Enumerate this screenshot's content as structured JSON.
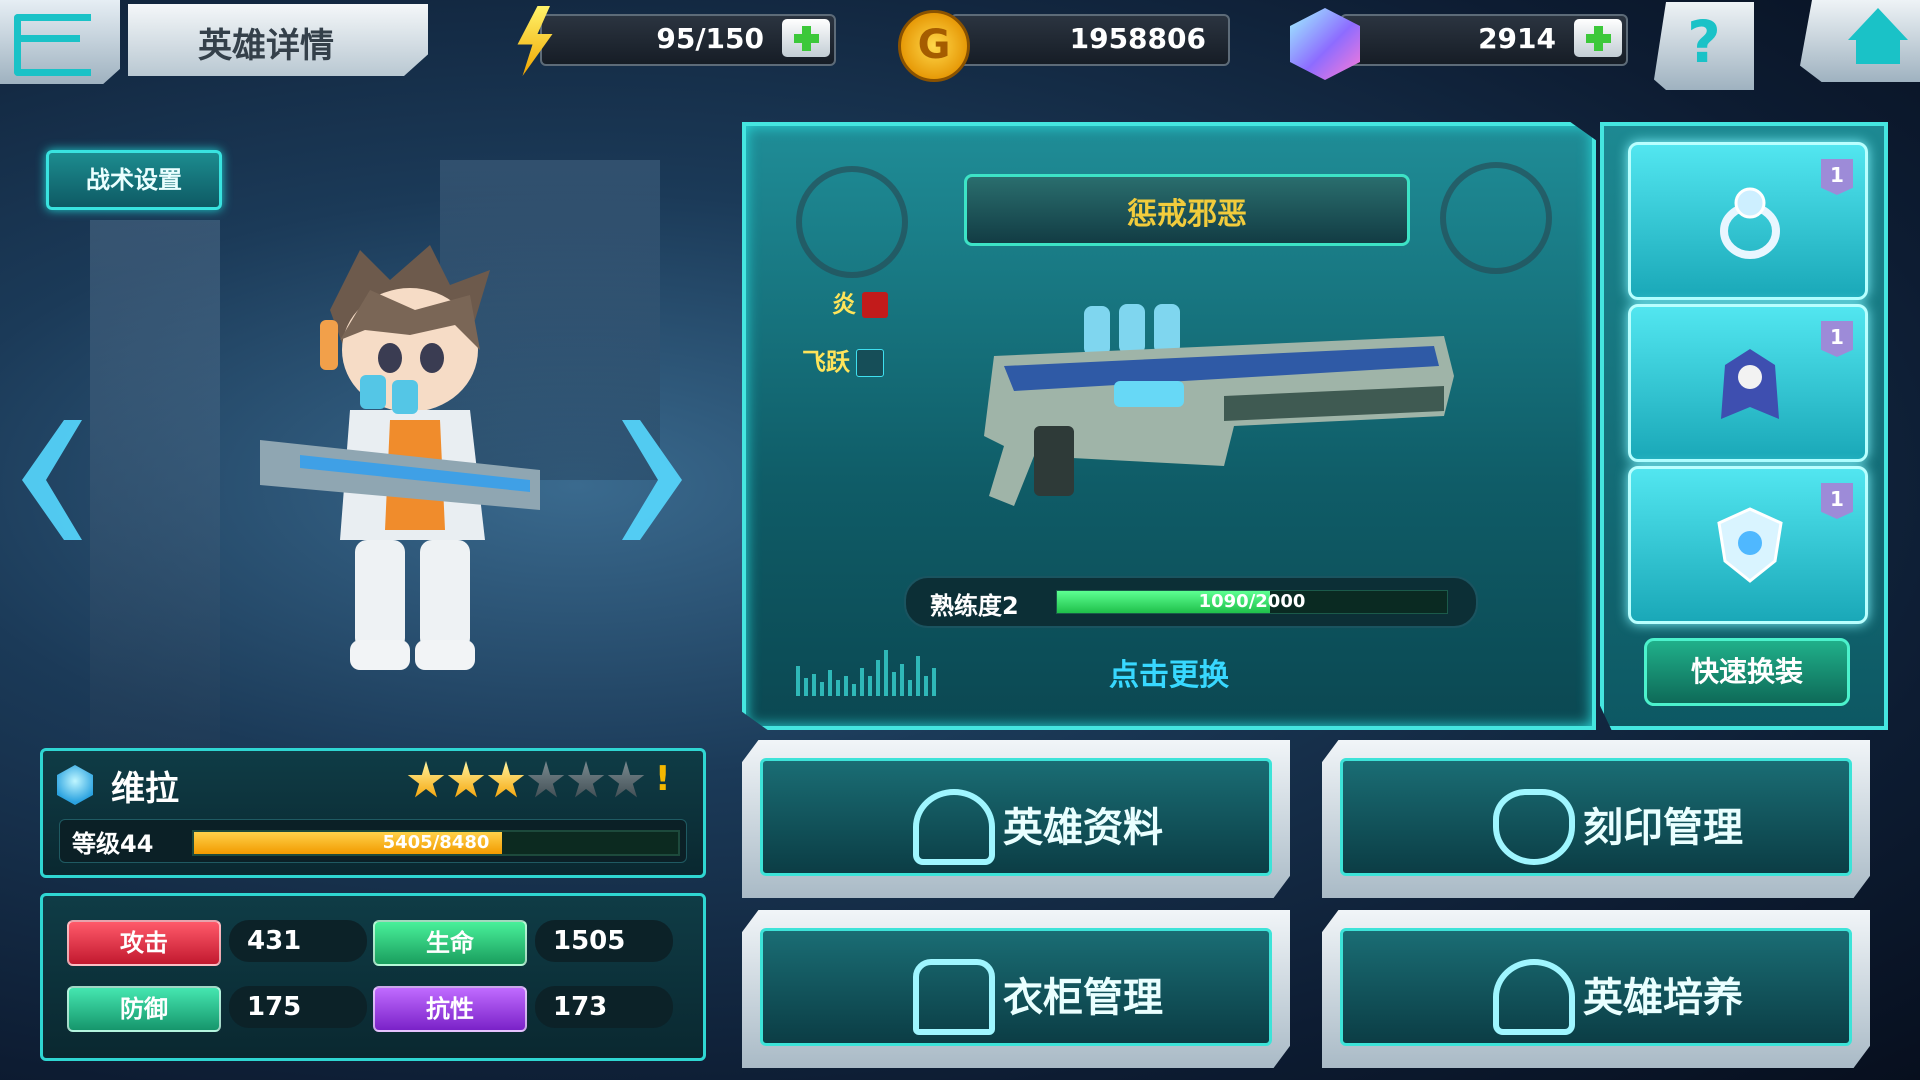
{
  "header": {
    "title": "英雄详情",
    "energy": "95/150",
    "gold": "1958806",
    "coin_symbol": "G",
    "gems": "2914",
    "help_symbol": "?"
  },
  "left": {
    "tactics_label": "战术设置"
  },
  "hero": {
    "name": "维拉",
    "stars_filled": 3,
    "stars_total": 6,
    "alert_symbol": "!",
    "level_label": "等级44",
    "exp_text": "5405/8480",
    "exp_fraction": 0.637,
    "stats": [
      {
        "label": "攻击",
        "value": "431",
        "color": "red"
      },
      {
        "label": "生命",
        "value": "1505",
        "color": "green"
      },
      {
        "label": "防御",
        "value": "175",
        "color": "teal"
      },
      {
        "label": "抗性",
        "value": "173",
        "color": "purple"
      }
    ]
  },
  "weapon": {
    "name": "惩戒邪恶",
    "attribute_1": "炎",
    "attribute_2": "飞跃",
    "proficiency_label": "熟练度2",
    "proficiency_text": "1090/2000",
    "proficiency_fraction": 0.545,
    "change_label": "点击更换"
  },
  "equipment": {
    "slots": [
      {
        "item": "ring-icon",
        "level": "1"
      },
      {
        "item": "cape-icon",
        "level": "1"
      },
      {
        "item": "shield-icon",
        "level": "1"
      }
    ],
    "quick_swap_label": "快速换装"
  },
  "menu": {
    "hero_info": "英雄资料",
    "imprint": "刻印管理",
    "wardrobe": "衣柜管理",
    "training": "英雄培养"
  },
  "colors": {
    "accent": "#2fd6d2",
    "gold_text": "#f2cc3c",
    "change_text": "#38d8ff"
  }
}
